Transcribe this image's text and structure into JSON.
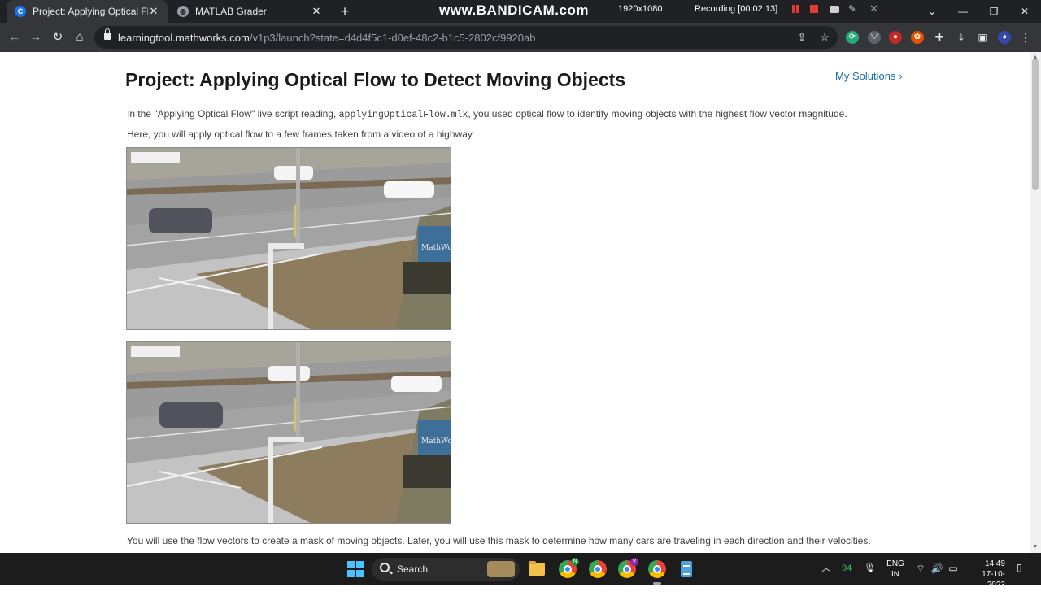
{
  "tabs": [
    {
      "title": "Project: Applying Optical Flow to",
      "favicon": "C"
    },
    {
      "title": "MATLAB Grader"
    }
  ],
  "recorder": {
    "brand": "www.BANDICAM.com",
    "resolution": "1920x1080",
    "status": "Recording [00:02:13]"
  },
  "toolbar": {
    "url_host": "learningtool.mathworks.com",
    "url_path": "/v1p3/launch?state=d4d4f5c1-d0ef-48c2-b1c5-2802cf9920ab"
  },
  "page": {
    "title": "Project: Applying Optical Flow to Detect Moving Objects",
    "my_solutions": "My Solutions",
    "para1_before": "In the \"Applying Optical Flow\" live script reading, ",
    "para1_code": "applyingOpticalFlow.mlx",
    "para1_after": ", you used optical flow to identify moving objects with the highest flow vector magnitude.",
    "para2": "Here, you will apply optical flow to a few frames taken from a video of a highway.",
    "para3": "You will use the flow vectors to create a mask of moving objects. Later, you will use this mask to determine how many cars are traveling in each direction and their velocities.",
    "sign_text": "MathWo"
  },
  "taskbar": {
    "search_label": "Search",
    "badge_n": "N",
    "badge_v": "V",
    "tray_num": "94",
    "lang_line1": "ENG",
    "lang_line2": "IN",
    "time": "14:49",
    "date": "17-10-2023"
  }
}
